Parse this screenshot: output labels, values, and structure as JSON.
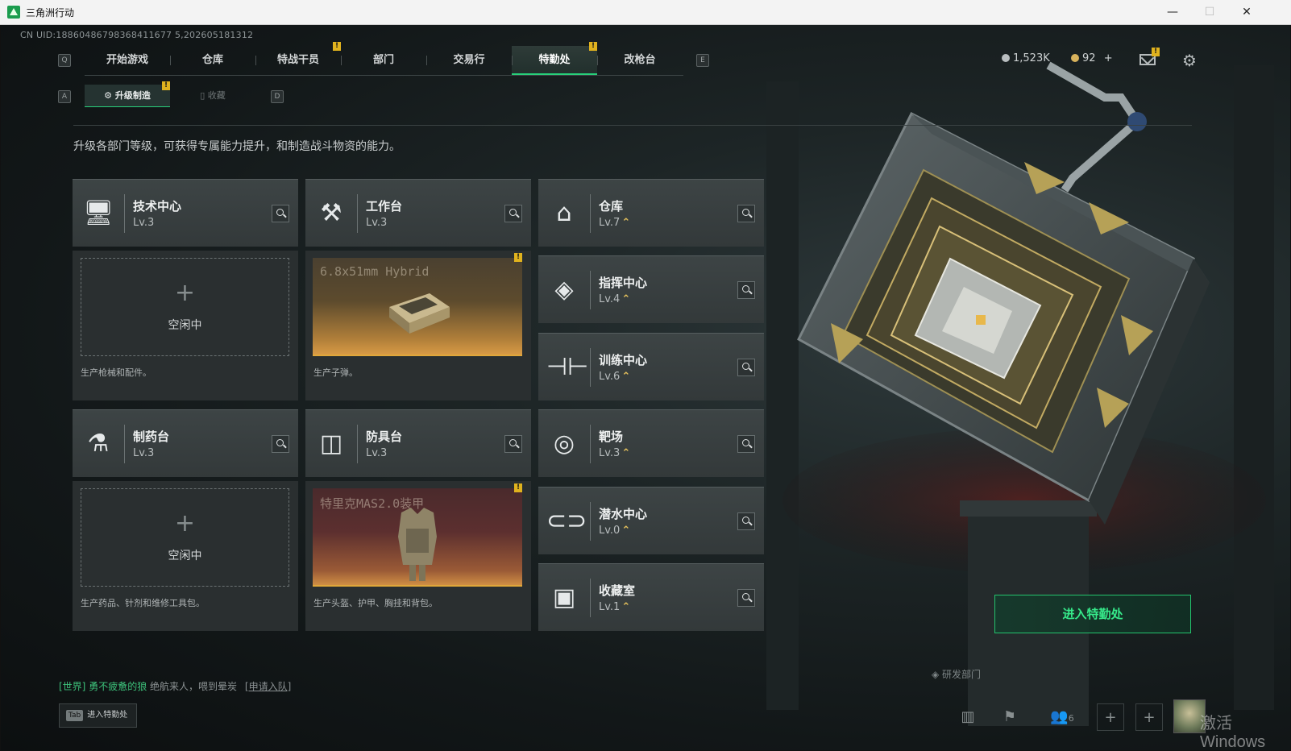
{
  "window": {
    "title": "三角洲行动",
    "minimize": "—",
    "maximize": "☐",
    "close": "✕"
  },
  "uid": "CN UID:18860486798368411677 5,202605181312",
  "topnav": {
    "key_left": "Q",
    "key_right": "E",
    "tabs": [
      "开始游戏",
      "仓库",
      "特战干员",
      "部门",
      "交易行",
      "特勤处",
      "改枪台"
    ],
    "active": "特勤处"
  },
  "currency": {
    "coins": "1,523K",
    "premium": "92",
    "add": "+"
  },
  "subnav": {
    "key_left": "A",
    "key_right": "D",
    "tabs": [
      "升级制造",
      "收藏"
    ]
  },
  "badge": "!",
  "description": "升级各部门等级，可获得专属能力提升，和制造战斗物资的能力。",
  "facilities": {
    "tech": {
      "name": "技术中心",
      "level": "Lv.3",
      "idle_label": "空闲中",
      "plus": "+",
      "caption": "生产枪械和配件。",
      "icon": "monitor-icon"
    },
    "workbench": {
      "name": "工作台",
      "level": "Lv.3",
      "product": "6.8x51mm Hybrid",
      "caption": "生产子弹。",
      "icon": "tools-icon"
    },
    "pharmacy": {
      "name": "制药台",
      "level": "Lv.3",
      "idle_label": "空闲中",
      "plus": "+",
      "caption": "生产药品、针剂和维修工具包。",
      "icon": "microscope-icon"
    },
    "armor": {
      "name": "防具台",
      "level": "Lv.3",
      "product": "特里克MAS2.0装甲",
      "caption": "生产头盔、护甲、胸挂和背包。",
      "icon": "cubes-icon"
    },
    "storage": {
      "name": "仓库",
      "level": "Lv.7",
      "icon": "vault-icon"
    },
    "command": {
      "name": "指挥中心",
      "level": "Lv.4",
      "icon": "diamond-target-icon"
    },
    "training": {
      "name": "训练中心",
      "level": "Lv.6",
      "icon": "dumbbell-icon"
    },
    "range": {
      "name": "靶场",
      "level": "Lv.3",
      "icon": "target-icon"
    },
    "diving": {
      "name": "潜水中心",
      "level": "Lv.0",
      "icon": "goggles-icon"
    },
    "collection": {
      "name": "收藏室",
      "level": "Lv.1",
      "icon": "display-case-icon"
    }
  },
  "upgrade_mark": "⌃",
  "enter_button": "进入特勤处",
  "chat": {
    "channel": "[世界]",
    "user": "勇不疲惫的狼",
    "message": "绝航来人，喂到晕炭",
    "link": "[申请入队]"
  },
  "tab_hint": {
    "key": "Tab",
    "label": "进入特勤处"
  },
  "friends_count": "6",
  "watermark": "激活 Windows"
}
